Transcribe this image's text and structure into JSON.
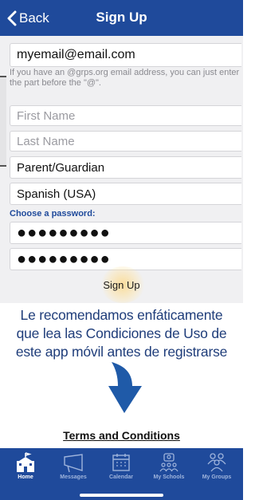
{
  "navbar": {
    "back_label": "Back",
    "title": "Sign Up"
  },
  "form": {
    "email_value": "myemail@email.com",
    "email_hint": "If you have an @grps.org email address, you can just enter the part before the \"@\".",
    "first_name_placeholder": "First Name",
    "last_name_placeholder": "Last Name",
    "role_value": "Parent/Guardian",
    "language_value": "Spanish (USA)",
    "password_label": "Choose a password:",
    "password_mask": "●●●●●●●●●",
    "confirm_password_mask": "●●●●●●●●●",
    "signup_label": "Sign Up"
  },
  "annotation": {
    "line1": "Le recomendamos enfáticamente",
    "line2": "que lea las Condiciones de Uso de",
    "line3": "este app móvil antes de registrarse"
  },
  "terms_link": "Terms and Conditions",
  "tabbar": {
    "tabs": [
      {
        "label": "Home",
        "icon": "school-building-icon",
        "active": true
      },
      {
        "label": "Messages",
        "icon": "megaphone-icon",
        "active": false
      },
      {
        "label": "Calendar",
        "icon": "calendar-icon",
        "active": false
      },
      {
        "label": "My Schools",
        "icon": "my-schools-icon",
        "active": false
      },
      {
        "label": "My Groups",
        "icon": "groups-icon",
        "active": false
      }
    ]
  },
  "colors": {
    "brand": "#1f4a9b",
    "annotation_text": "#1f3d7a",
    "background": "#f0f0f2"
  }
}
